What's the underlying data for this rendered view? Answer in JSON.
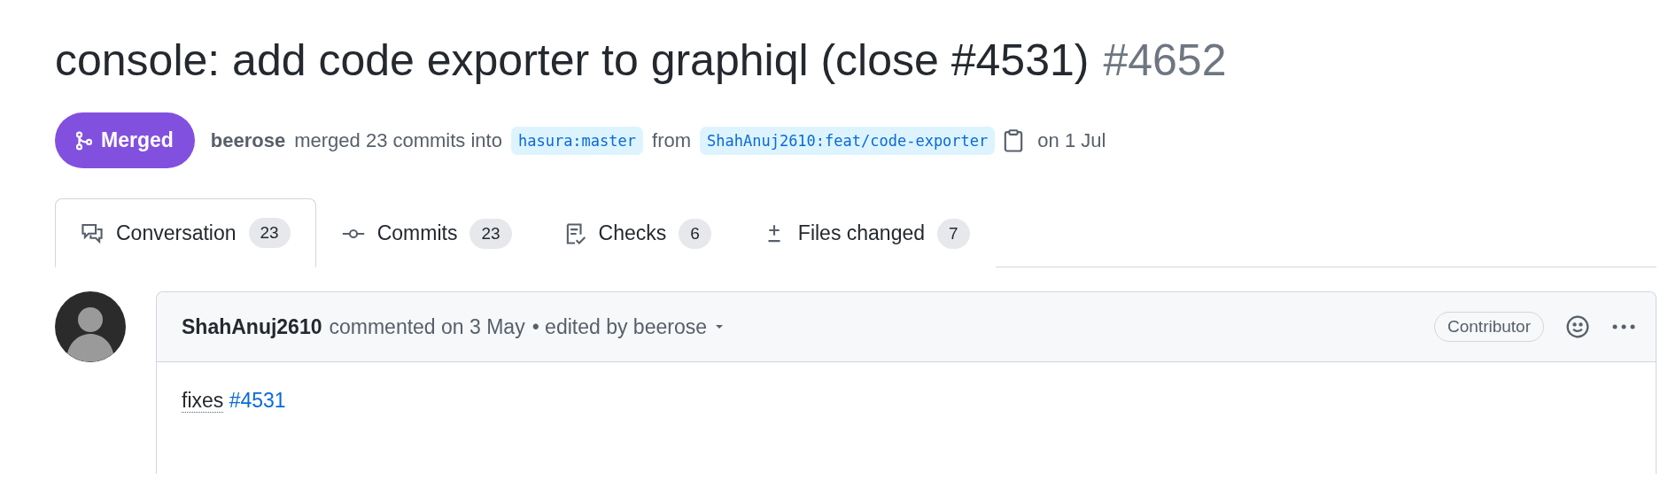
{
  "title": {
    "text": "console: add code exporter to graphiql (close #4531)",
    "number": "#4652"
  },
  "state": {
    "kind": "merged",
    "label": "Merged"
  },
  "meta": {
    "author": "beerose",
    "action": "merged 23 commits into",
    "base": "hasura:master",
    "from": "from",
    "head": "ShahAnuj2610:feat/code-exporter",
    "date": "on 1 Jul"
  },
  "tabs": [
    {
      "kind": "conversation",
      "label": "Conversation",
      "count": "23",
      "selected": true
    },
    {
      "kind": "commits",
      "label": "Commits",
      "count": "23",
      "selected": false
    },
    {
      "kind": "checks",
      "label": "Checks",
      "count": "6",
      "selected": false
    },
    {
      "kind": "files",
      "label": "Files changed",
      "count": "7",
      "selected": false
    }
  ],
  "comment": {
    "author": "ShahAnuj2610",
    "action": "commented on 3 May",
    "edited": "• edited by beerose",
    "badge": "Contributor",
    "body_text": "fixes",
    "body_link": "#4531"
  }
}
